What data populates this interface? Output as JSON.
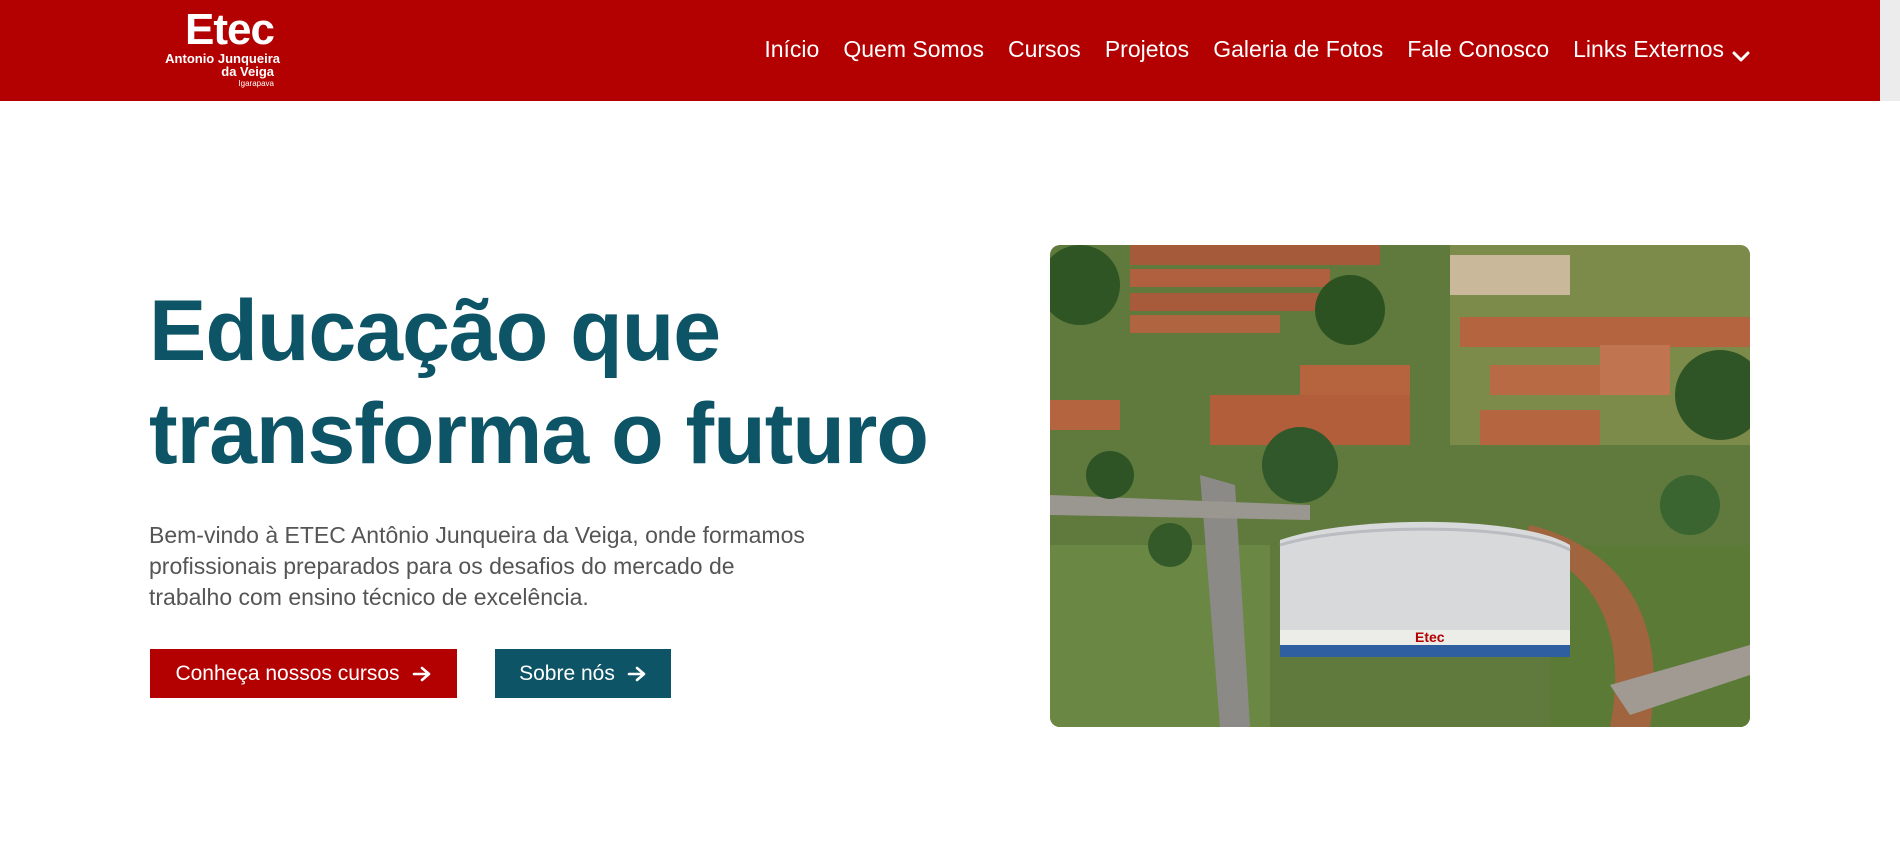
{
  "brand": {
    "logo_word": "Etec",
    "logo_line1": "Antonio Junqueira",
    "logo_line2": "da Veiga",
    "logo_line3": "Igarapava"
  },
  "nav": {
    "items": [
      {
        "label": "Início"
      },
      {
        "label": "Quem Somos"
      },
      {
        "label": "Cursos"
      },
      {
        "label": "Projetos"
      },
      {
        "label": "Galeria de Fotos"
      },
      {
        "label": "Fale Conosco"
      },
      {
        "label": "Links Externos",
        "icon": "chevron-down-icon"
      }
    ]
  },
  "hero": {
    "title_line1": "Educação que",
    "title_line2": "transforma o futuro",
    "description": "Bem-vindo à ETEC Antônio Junqueira da Veiga, onde formamos profissionais preparados para os desafios do mercado de trabalho com ensino técnico de excelência.",
    "primary_button": "Conheça nossos cursos",
    "secondary_button": "Sobre nós",
    "button_icon": "arrow-right-icon",
    "image_alt": "aerial-campus-photo"
  },
  "colors": {
    "brand_red": "#b30000",
    "brand_teal": "#0d5566",
    "text_gray": "#555555"
  }
}
